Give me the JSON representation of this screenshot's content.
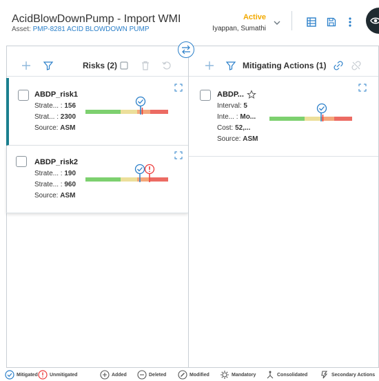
{
  "header": {
    "title": "AcidBlowDownPump - Import WMI",
    "asset_prefix": "Asset:",
    "asset_link": "PMP-8281 ACID BLOWDOWN PUMP",
    "status": "Active",
    "owner": "Iyappan, Sumathi"
  },
  "risks_panel": {
    "title": "Risks (2)",
    "cards": [
      {
        "name": "ABDP_risk1",
        "line1_label": "Strate... :",
        "line1_value": "156",
        "line2_label": "Strat... :",
        "line2_value": "2300",
        "line3_label": "Source:",
        "line3_value": "ASM"
      },
      {
        "name": "ABDP_risk2",
        "line1_label": "Strate... :",
        "line1_value": "190",
        "line2_label": "Strate... :",
        "line2_value": "960",
        "line3_label": "Source:",
        "line3_value": "ASM"
      }
    ]
  },
  "actions_panel": {
    "title": "Mitigating Actions (1)",
    "cards": [
      {
        "name": "ABDP...",
        "line1_label": "Interval:",
        "line1_value": "5",
        "line2_label": "Inte... :",
        "line2_value": "Mo...",
        "line3_label": "Cost:",
        "line3_value": "52,...",
        "line4_label": "Source:",
        "line4_value": "ASM"
      }
    ]
  },
  "legend": {
    "mitigated": "Mitigated",
    "unmitigated": "Unmitigated",
    "added": "Added",
    "deleted": "Deleted",
    "modified": "Modified",
    "mandatory": "Mandatory",
    "consolidated": "Consolidated",
    "secondary": "Secondary Actions"
  },
  "colors": {
    "accent": "#2a7fc9",
    "status": "#f2a900",
    "selected": "#1a7f8e",
    "green": "#7dd06f",
    "yellow": "#ecdf9b",
    "orange": "#f4a77a",
    "red": "#ec6b63"
  }
}
